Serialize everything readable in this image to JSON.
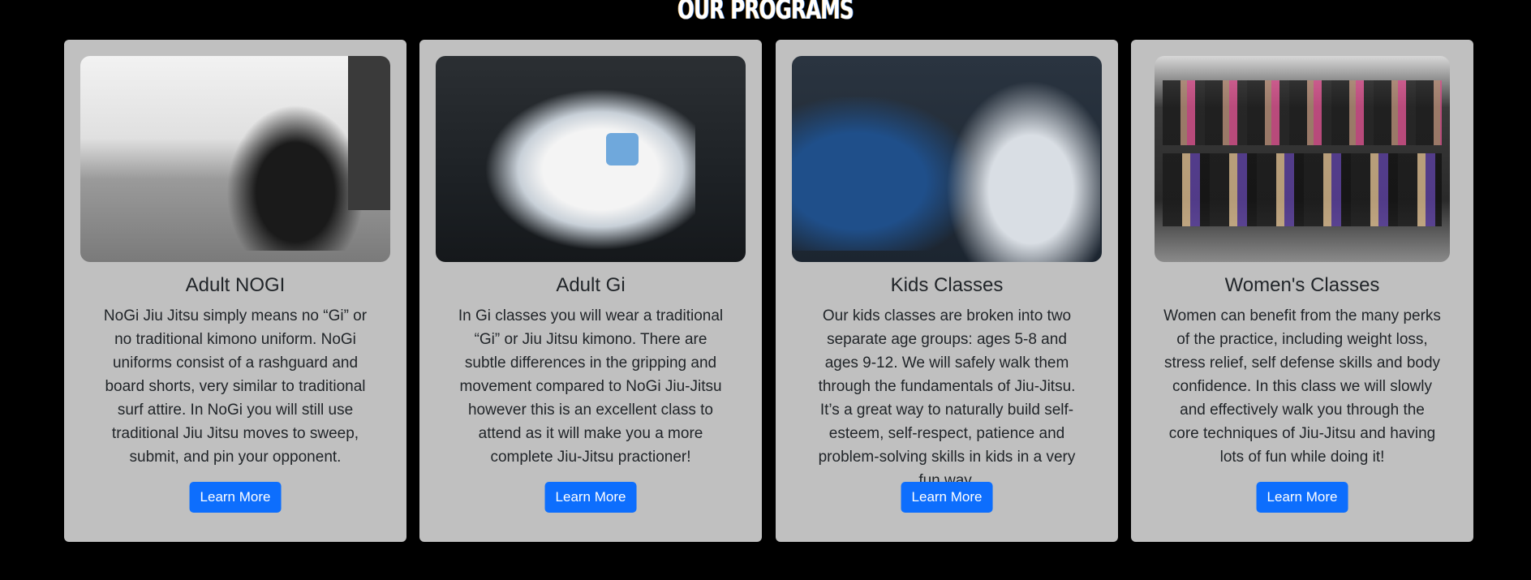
{
  "section_title": "OUR PROGRAMS",
  "programs": [
    {
      "title": "Adult NOGI",
      "description": "NoGi Jiu Jitsu simply means no “Gi” or no traditional kimono uniform. NoGi uniforms consist of a rashguard and board shorts, very similar to traditional surf attire. In NoGi you will still use traditional Jiu Jitsu moves to sweep, submit, and pin your opponent.",
      "button": "Learn More"
    },
    {
      "title": "Adult Gi",
      "description": "In Gi classes you will wear a traditional “Gi” or Jiu Jitsu kimono. There are subtle differences in the gripping and movement compared to NoGi Jiu-Jitsu however this is an excellent class to attend as it will make you a more complete Jiu-Jitsu practioner!",
      "button": "Learn More"
    },
    {
      "title": "Kids Classes",
      "description": "Our kids classes are broken into two separate age groups: ages 5-8 and ages 9-12. We will safely walk them through the fundamentals of Jiu-Jitsu. It’s a great way to naturally build self-esteem, self-respect, patience and problem-solving skills in kids in a very fun way.",
      "button": "Learn More"
    },
    {
      "title": "Women's Classes",
      "description": "Women can benefit from the many perks of the practice, including weight loss, stress relief, self defense skills and body confidence. In this class we will slowly and effectively walk you through the core techniques of Jiu-Jitsu and having lots of fun while doing it!",
      "button": "Learn More"
    }
  ],
  "colors": {
    "background": "#000000",
    "card": "#c0c0c0",
    "button": "#0d6efd"
  }
}
